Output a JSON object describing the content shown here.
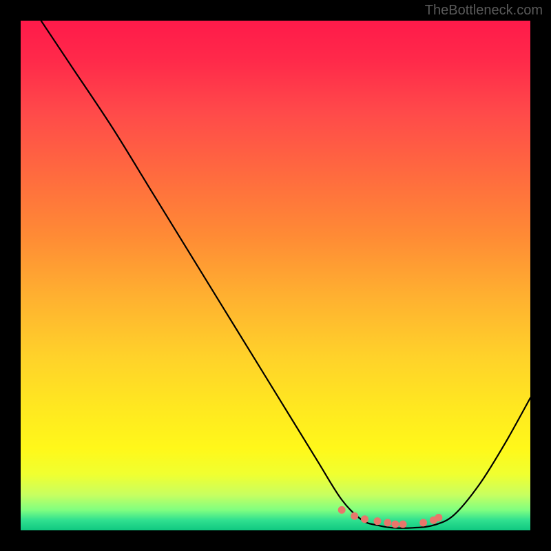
{
  "watermark": "TheBottleneck.com",
  "chart_data": {
    "type": "line",
    "title": "",
    "xlabel": "",
    "ylabel": "",
    "xlim": [
      0,
      100
    ],
    "ylim": [
      0,
      100
    ],
    "series": [
      {
        "name": "bottleneck-curve",
        "x": [
          4,
          10,
          18,
          26,
          34,
          42,
          50,
          58,
          63,
          67,
          70,
          73,
          77,
          81,
          85,
          90,
          95,
          100
        ],
        "values": [
          100,
          91,
          79,
          66,
          53,
          40,
          27,
          14,
          6,
          2,
          1,
          0.5,
          0.5,
          1,
          3,
          9,
          17,
          26
        ]
      }
    ],
    "markers": {
      "name": "highlight-dots",
      "x": [
        63,
        65.5,
        67.5,
        70,
        72,
        73.5,
        75,
        79,
        81,
        82
      ],
      "values": [
        4,
        2.8,
        2.2,
        1.8,
        1.5,
        1.2,
        1.2,
        1.5,
        2.0,
        2.5
      ]
    },
    "gradient_stops": [
      {
        "pos": 0,
        "color": "#ff1a4a"
      },
      {
        "pos": 18,
        "color": "#ff4a4a"
      },
      {
        "pos": 42,
        "color": "#ff8a35"
      },
      {
        "pos": 66,
        "color": "#ffd22a"
      },
      {
        "pos": 84,
        "color": "#fff81a"
      },
      {
        "pos": 96,
        "color": "#80ff80"
      },
      {
        "pos": 100,
        "color": "#10c880"
      }
    ]
  }
}
